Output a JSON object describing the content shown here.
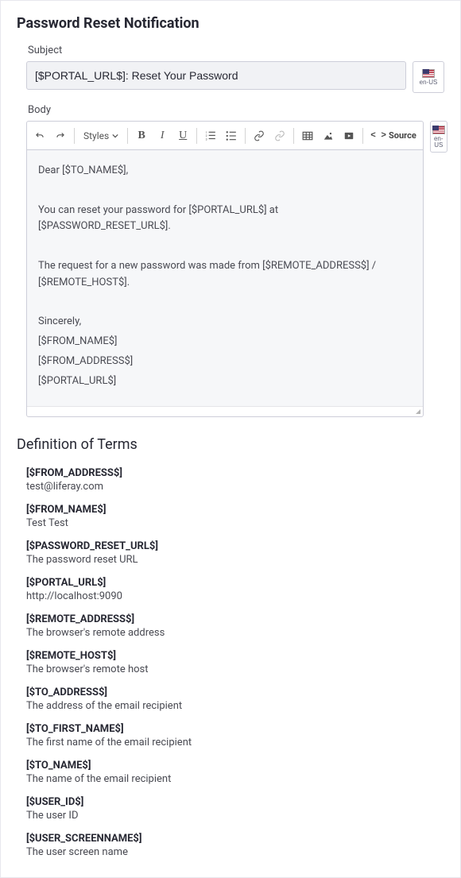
{
  "page_title": "Password Reset Notification",
  "locale_label": "en-US",
  "subject": {
    "label": "Subject",
    "value": "[$PORTAL_URL$]: Reset Your Password"
  },
  "body": {
    "label": "Body"
  },
  "toolbar": {
    "styles_label": "Styles",
    "source_label": "Source"
  },
  "email_body": {
    "greeting": "Dear [$TO_NAME$],",
    "line1": "You can reset your password for [$PORTAL_URL$] at [$PASSWORD_RESET_URL$].",
    "line2": "The request for a new password was made from [$REMOTE_ADDRESS$] / [$REMOTE_HOST$].",
    "closing1": "Sincerely,",
    "closing2": "[$FROM_NAME$]",
    "closing3": "[$FROM_ADDRESS$]",
    "closing4": "[$PORTAL_URL$]"
  },
  "definitions_heading": "Definition of Terms",
  "terms": [
    {
      "key": "[$FROM_ADDRESS$]",
      "desc": "test@liferay.com"
    },
    {
      "key": "[$FROM_NAME$]",
      "desc": "Test Test"
    },
    {
      "key": "[$PASSWORD_RESET_URL$]",
      "desc": "The password reset URL"
    },
    {
      "key": "[$PORTAL_URL$]",
      "desc": "http://localhost:9090"
    },
    {
      "key": "[$REMOTE_ADDRESS$]",
      "desc": "The browser's remote address"
    },
    {
      "key": "[$REMOTE_HOST$]",
      "desc": "The browser's remote host"
    },
    {
      "key": "[$TO_ADDRESS$]",
      "desc": "The address of the email recipient"
    },
    {
      "key": "[$TO_FIRST_NAME$]",
      "desc": "The first name of the email recipient"
    },
    {
      "key": "[$TO_NAME$]",
      "desc": "The name of the email recipient"
    },
    {
      "key": "[$USER_ID$]",
      "desc": "The user ID"
    },
    {
      "key": "[$USER_SCREENNAME$]",
      "desc": "The user screen name"
    }
  ]
}
